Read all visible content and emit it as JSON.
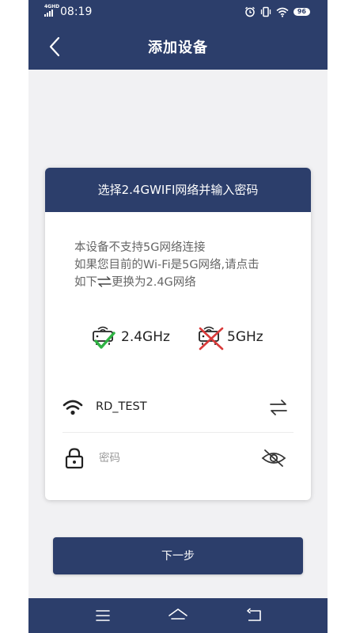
{
  "status_bar": {
    "network": "4G",
    "network_sup": "HD",
    "time": "08:19",
    "battery": "96",
    "icons": [
      "signal-icon",
      "alarm-icon",
      "vibrate-icon",
      "wifi-icon",
      "battery-icon"
    ]
  },
  "header": {
    "title": "添加设备",
    "back_icon": "chevron-left-icon"
  },
  "card": {
    "title": "选择2.4GWIFI网络并输入密码",
    "notice_line1": "本设备不支持5G网络连接",
    "notice_line2": "如果您目前的Wi-Fi是5G网络,请点击",
    "notice_line3_before": "如下",
    "notice_line3_after": "更换为2.4G网络",
    "band_supported": {
      "label": "2.4GHz",
      "status": "supported"
    },
    "band_unsupported": {
      "label": "5GHz",
      "status": "unsupported"
    },
    "ssid": "RD_TEST",
    "password_placeholder": "密码",
    "password_value": ""
  },
  "next_button": "下一步",
  "colors": {
    "primary": "#2c3e6b",
    "background": "#f1f1f3",
    "check_green": "#2fb344",
    "cross_red": "#d93a3a"
  }
}
